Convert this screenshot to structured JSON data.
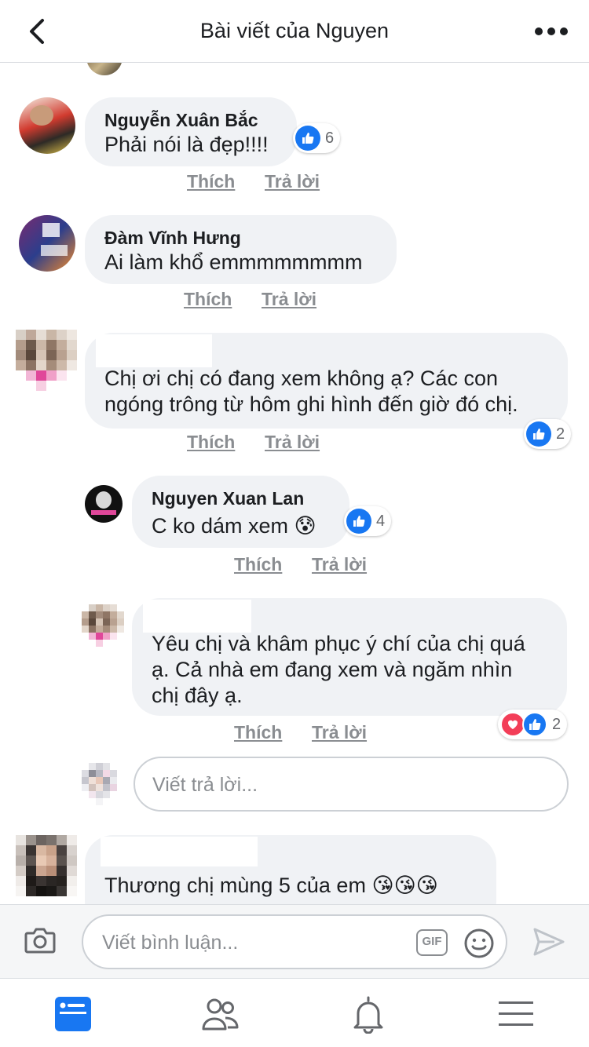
{
  "header": {
    "title": "Bài viết của Nguyen"
  },
  "actions": {
    "like": "Thích",
    "reply": "Trả lời"
  },
  "comments": [
    {
      "name": "Nguyễn Xuân Bắc",
      "text": "Phải nói là đẹp!!!!",
      "likes": "6"
    },
    {
      "name": "Đàm Vĩnh Hưng",
      "text": "Ai làm khổ emmmmmmmm"
    },
    {
      "name": "",
      "lines": [
        "Chị ơi chị có đang xem không ạ? Các con",
        "ngóng trông từ hôm ghi hình đến giờ đó chị."
      ],
      "likes": "2"
    },
    {
      "name": "Nguyen Xuan Lan",
      "text": "C ko dám xem 😰",
      "likes": "4"
    },
    {
      "name": "",
      "lines": [
        "Yêu chị và khâm phục ý chí của chị quá",
        "ạ. Cả nhà em đang xem và ngăm nhìn",
        "chị đây ạ."
      ],
      "reactions": "2"
    },
    {
      "name": "",
      "text": "Thương chị mùng 5 của em 😘😘😘"
    }
  ],
  "reply_input": {
    "placeholder": "Viết trả lời..."
  },
  "composer": {
    "placeholder": "Viết bình luận...",
    "gif": "GIF"
  },
  "icons": [
    "back-arrow-icon",
    "more-icon",
    "like-icon",
    "love-icon",
    "camera-icon",
    "emoji-icon",
    "send-icon",
    "news-feed-icon",
    "friends-icon",
    "notifications-icon",
    "menu-icon"
  ],
  "colors": {
    "like_blue": "#1877f2",
    "love_red": "#f33e58",
    "bubble": "#f0f2f5",
    "active_tab": "#1877f2",
    "inactive": "#65676b"
  }
}
